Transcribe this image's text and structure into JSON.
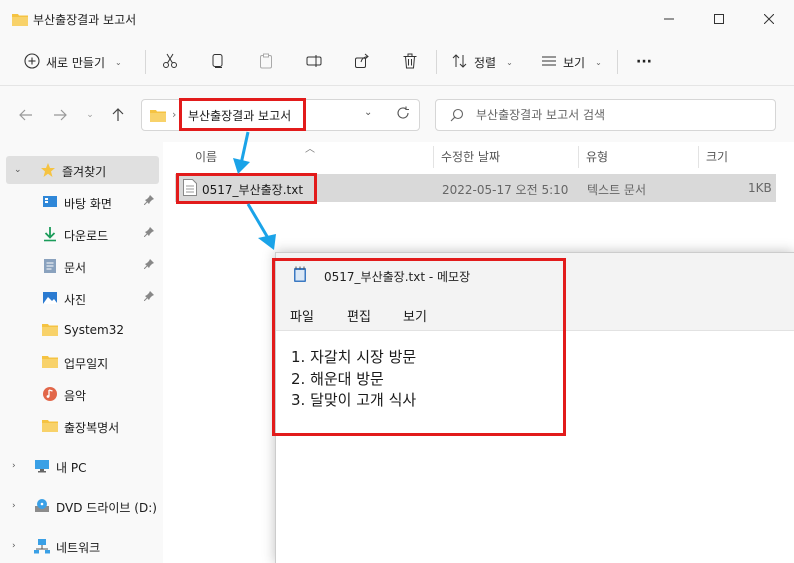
{
  "explorer": {
    "title": "부산출장결과 보고서",
    "toolbar": {
      "new_label": "새로 만들기",
      "sort_label": "정렬",
      "view_label": "보기",
      "more_label": "···"
    },
    "address": {
      "path": "부산출장결과 보고서",
      "search_placeholder": "부산출장결과 보고서 검색"
    },
    "sidebar": {
      "items": [
        {
          "label": "즐겨찾기",
          "icon": "star-icon"
        },
        {
          "label": "바탕 화면",
          "icon": "desktop-icon"
        },
        {
          "label": "다운로드",
          "icon": "download-icon"
        },
        {
          "label": "문서",
          "icon": "document-icon"
        },
        {
          "label": "사진",
          "icon": "picture-icon"
        },
        {
          "label": "System32",
          "icon": "folder-icon"
        },
        {
          "label": "업무일지",
          "icon": "folder-icon"
        },
        {
          "label": "음악",
          "icon": "music-icon"
        },
        {
          "label": "출장복명서",
          "icon": "folder-icon"
        },
        {
          "label": "내 PC",
          "icon": "pc-icon"
        },
        {
          "label": "DVD 드라이브 (D:)",
          "icon": "dvd-icon"
        },
        {
          "label": "네트워크",
          "icon": "network-icon"
        }
      ]
    },
    "columns": {
      "name": "이름",
      "modified": "수정한 날짜",
      "type": "유형",
      "size": "크기"
    },
    "files": [
      {
        "name": "0517_부산출장.txt",
        "modified": "2022-05-17 오전 5:10",
        "type": "텍스트 문서",
        "size": "1KB"
      }
    ]
  },
  "notepad": {
    "title": "0517_부산출장.txt - 메모장",
    "menu": [
      "파일",
      "편집",
      "보기"
    ],
    "lines": [
      "1. 자갈치 시장 방문",
      "2. 해운대 방문",
      "3. 달맞이 고개 식사"
    ]
  },
  "colors": {
    "highlight": "#e21b1b",
    "arrow": "#1aa3e8",
    "folder": "#f5c342",
    "selection": "#d9d9d9"
  }
}
